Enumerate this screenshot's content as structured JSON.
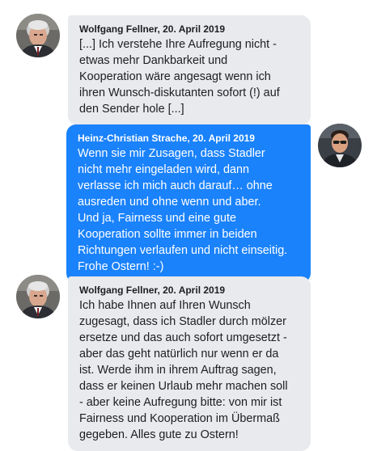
{
  "messages": [
    {
      "sender": "Wolfgang Fellner, 20. April 2019",
      "avatar": "avatar-fellner",
      "direction": "incoming",
      "text": "[...] Ich verstehe Ihre Aufregung nicht -\netwas mehr Dankbarkeit und\nKooperation wäre angesagt wenn ich\nihren Wunsch-diskutanten sofort (!) auf\nden Sender hole [...]"
    },
    {
      "sender": "Heinz-Christian Strache, 20. April 2019",
      "avatar": "avatar-strache",
      "direction": "outgoing",
      "text": "Wenn sie mir Zusagen, dass Stadler\nnicht mehr eingeladen wird, dann\nverlasse ich mich auch darauf… ohne\nausreden und ohne wenn und aber.\nUnd ja, Fairness und eine gute\nKooperation sollte immer in beiden\nRichtungen verlaufen und nicht einseitig.\nFrohe Ostern! :-)"
    },
    {
      "sender": "Wolfgang Fellner, 20. April 2019",
      "avatar": "avatar-fellner",
      "direction": "incoming",
      "text": "Ich habe Ihnen auf Ihren Wunsch\nzugesagt, dass ich Stadler durch mölzer\nersetze und das auch sofort umgesetzt -\naber das geht natürlich nur wenn er da\nist. Werde ihm in ihrem Auftrag sagen,\ndass er keinen Urlaub mehr machen soll\n- aber keine Aufregung bitte: von mir ist\nFairness und Kooperation im Übermaß\ngegeben. Alles gute zu Ostern!"
    }
  ],
  "colors": {
    "incoming_bubble": "#e9eaee",
    "outgoing_bubble": "#1a82fb",
    "incoming_text": "#1c1e21",
    "outgoing_text": "#ffffff"
  }
}
